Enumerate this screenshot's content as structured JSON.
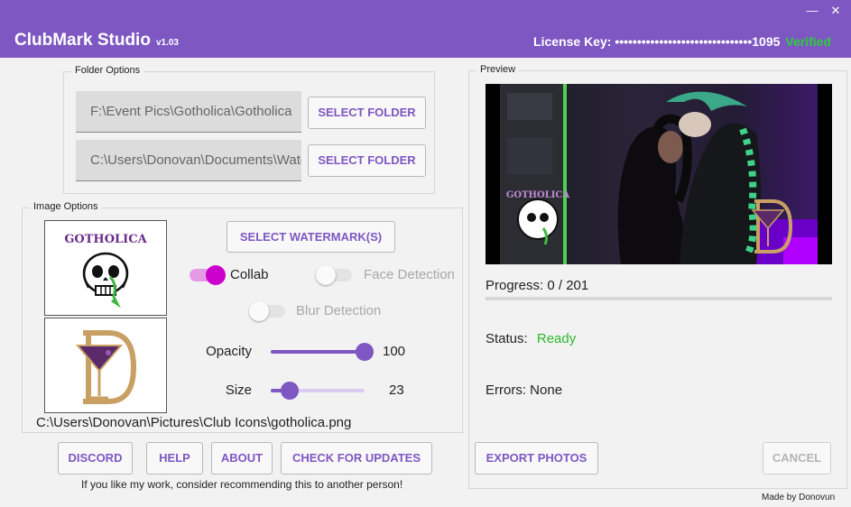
{
  "titlebar": {
    "title": "ClubMark Studio",
    "version": "v1.03",
    "license_label": "License Key:",
    "license_value": "•••••••••••••••••••••••••••••••1095",
    "license_status": "Verified",
    "minimize_glyph": "—",
    "close_glyph": "✕"
  },
  "folder_options": {
    "legend": "Folder Options",
    "input_folder": "F:\\Event Pics\\Gotholica\\Gotholica",
    "output_folder": "C:\\Users\\Donovan\\Documents\\Watermarked",
    "select_label_1": "SELECT FOLDER",
    "select_label_2": "SELECT FOLDER"
  },
  "image_options": {
    "legend": "Image Options",
    "select_watermark_label": "SELECT WATERMARK(S)",
    "collab_label": "Collab",
    "collab_on": true,
    "face_detection_label": "Face Detection",
    "face_detection_on": false,
    "blur_detection_label": "Blur Detection",
    "blur_detection_on": false,
    "opacity_label": "Opacity",
    "opacity_value": "100",
    "opacity_fraction": 1.0,
    "size_label": "Size",
    "size_value": "23",
    "size_fraction": 0.2,
    "watermark_path": "C:\\Users\\Donovan\\Pictures\\Club Icons\\gotholica.png",
    "watermark_1_text": "GOTHOLICA"
  },
  "preview": {
    "legend": "Preview",
    "progress_label": "Progress:",
    "progress_value": "0 / 201",
    "progress_fraction": 0,
    "status_label": "Status:",
    "status_value": "Ready",
    "errors_label": "Errors:",
    "errors_value": "None",
    "overlay_text": "GOTHOLICA"
  },
  "buttons": {
    "discord": "DISCORD",
    "help": "HELP",
    "about": "ABOUT",
    "check_updates": "CHECK FOR UPDATES",
    "export": "EXPORT PHOTOS",
    "cancel": "CANCEL"
  },
  "footer": {
    "recommend": "If you like my work, consider recommending this to another person!",
    "credit": "Made by Donovun"
  },
  "colors": {
    "accent": "#7e57c2",
    "verified": "#2ecc40",
    "ready": "#2eb82e",
    "toggle_on": "#cc00cc"
  }
}
